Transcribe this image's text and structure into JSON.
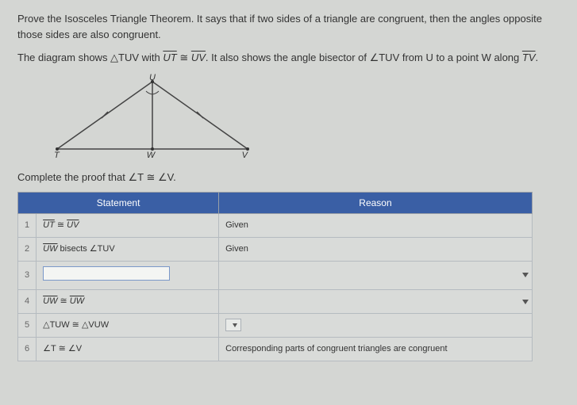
{
  "intro": {
    "p1": "Prove the Isosceles Triangle Theorem. It says that if two sides of a triangle are congruent, then the angles opposite those sides are also congruent.",
    "p2_prefix": "The diagram shows △TUV with ",
    "ut": "UT",
    "cong": " ≅ ",
    "uv": "UV",
    "p2_mid": ". It also shows the angle bisector of ∠TUV from U to a point W along ",
    "tv": "TV",
    "p2_end": "."
  },
  "diagram": {
    "U": "U",
    "T": "T",
    "W": "W",
    "V": "V"
  },
  "sub": "Complete the proof that ∠T ≅ ∠V.",
  "table": {
    "h_stmt": "Statement",
    "h_reason": "Reason",
    "rows": [
      {
        "n": "1",
        "stmt_html": "UT ≅ UV",
        "stmt_over": true,
        "reason": "Given"
      },
      {
        "n": "2",
        "stmt_html": "UW bisects ∠TUV",
        "stmt_over_part": "UW",
        "stmt_rest": " bisects ∠TUV",
        "reason": "Given"
      },
      {
        "n": "3",
        "stmt_html": "",
        "reason": ""
      },
      {
        "n": "4",
        "stmt_html": "UW ≅ UW",
        "stmt_over": true,
        "reason": ""
      },
      {
        "n": "5",
        "stmt_html": "△TUW ≅ △VUW",
        "reason": ""
      },
      {
        "n": "6",
        "stmt_html": "∠T ≅ ∠V",
        "reason": "Corresponding parts of congruent triangles are congruent"
      }
    ],
    "r1n": "1",
    "r2n": "2",
    "r3n": "3",
    "r4n": "4",
    "r5n": "5",
    "r6n": "6",
    "r1r": "Given",
    "r2r": "Given",
    "r3r": "",
    "r4r": "",
    "r6r": "Corresponding parts of congruent triangles are congruent",
    "r2rest": " bisects ∠TUV",
    "r5s": "△TUW ≅ △VUW",
    "r6s": "∠T ≅ ∠V",
    "ut": "UT",
    "uv": "UV",
    "uw": "UW"
  }
}
